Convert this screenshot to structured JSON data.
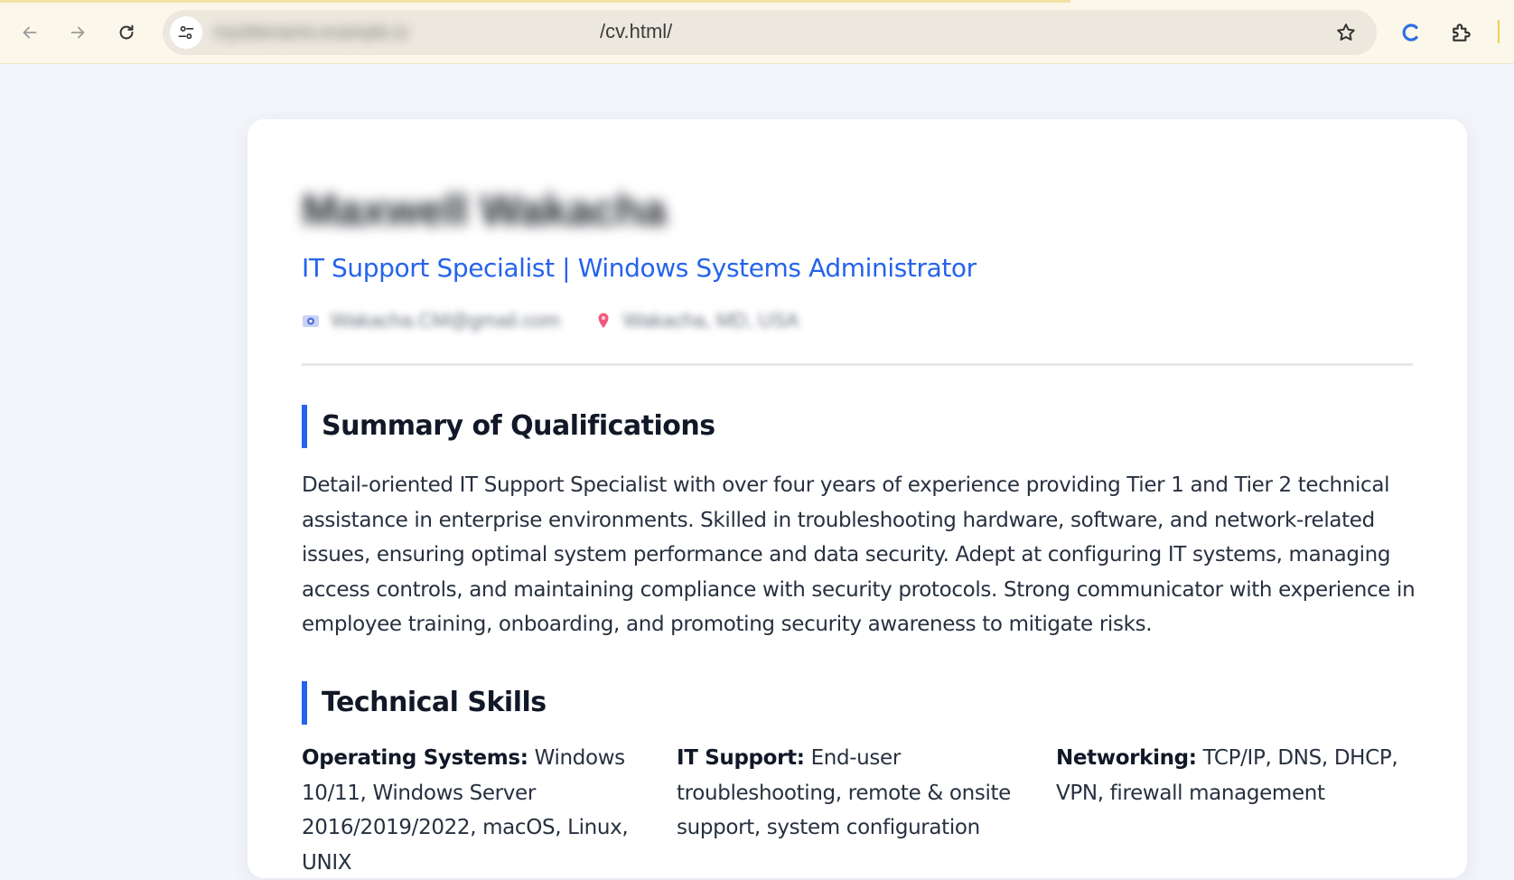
{
  "browser": {
    "url_host": "mystitename.example.io",
    "url_path": "/cv.html/",
    "icons": {
      "back": "arrow-left-icon",
      "forward": "arrow-right-icon",
      "reload": "reload-icon",
      "site_info": "tune-icon",
      "bookmark": "star-outline-icon",
      "extension_c": "c-logo-icon",
      "extensions": "puzzle-icon"
    },
    "colors": {
      "toolbar_bg": "#fbf7ea",
      "omnibox_bg": "#ece8de",
      "extension_c": "#2f6fe6"
    }
  },
  "cv": {
    "name": "Maxwell Wakacha",
    "subtitle": "IT Support Specialist | Windows Systems Administrator",
    "contact": {
      "email": "Wakacha.CM@gmail.com",
      "location": "Wakacha, MD, USA"
    },
    "sections": {
      "summary": {
        "heading": "Summary of Qualifications",
        "text": "Detail-oriented IT Support Specialist with over four years of experience providing Tier 1 and Tier 2 technical assistance in enterprise environments. Skilled in troubleshooting hardware, software, and network-related issues, ensuring optimal system performance and data security. Adept at configuring IT systems, managing access controls, and maintaining compliance with security protocols. Strong communicator with experience in employee training, onboarding, and promoting security awareness to mitigate risks."
      },
      "skills": {
        "heading": "Technical Skills",
        "items": [
          {
            "label": "Operating Systems:",
            "value": "Windows 10/11, Windows Server 2016/2019/2022, macOS, Linux, UNIX"
          },
          {
            "label": "IT Support:",
            "value": "End-user troubleshooting, remote & onsite support, system configuration"
          },
          {
            "label": "Networking:",
            "value": "TCP/IP, DNS, DHCP, VPN, firewall management"
          }
        ]
      }
    },
    "colors": {
      "accent": "#2563eb",
      "heading_text": "#111827",
      "body_text": "#27303f",
      "page_bg": "#f3f5fa",
      "card_bg": "#ffffff"
    }
  }
}
